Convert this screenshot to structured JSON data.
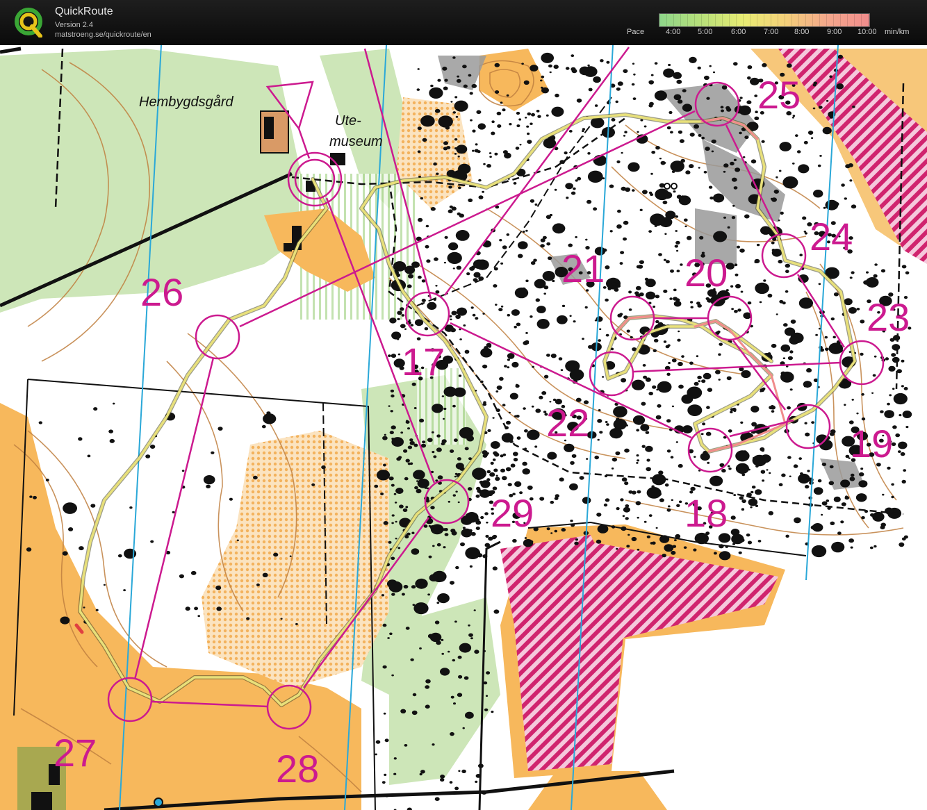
{
  "app": {
    "name": "QuickRoute",
    "version": "Version 2.4",
    "url": "matstroeng.se/quickroute/en"
  },
  "pace_scale": {
    "label": "Pace",
    "ticks": [
      "4:00",
      "5:00",
      "6:00",
      "7:00",
      "8:00",
      "9:00",
      "10:00"
    ],
    "unit": "min/km"
  },
  "map": {
    "place_labels": {
      "hembygdsgard": "Hembygdsgård",
      "ute_line1": "Ute-",
      "ute_line2": "museum"
    },
    "controls": [
      {
        "number": "17"
      },
      {
        "number": "18"
      },
      {
        "number": "19"
      },
      {
        "number": "20"
      },
      {
        "number": "21"
      },
      {
        "number": "22"
      },
      {
        "number": "23"
      },
      {
        "number": "24"
      },
      {
        "number": "25"
      },
      {
        "number": "26"
      },
      {
        "number": "27"
      },
      {
        "number": "28"
      },
      {
        "number": "29"
      }
    ],
    "colors": {
      "course": "#cc1a8f",
      "route": "#e8e07a",
      "open_land": "#f7b85c",
      "forest_green": "#c5e3b0",
      "contour": "#c08040",
      "magnetic_north": "#2aa8d8",
      "out_of_bounds": "#d0246e",
      "rock": "#111111"
    }
  }
}
